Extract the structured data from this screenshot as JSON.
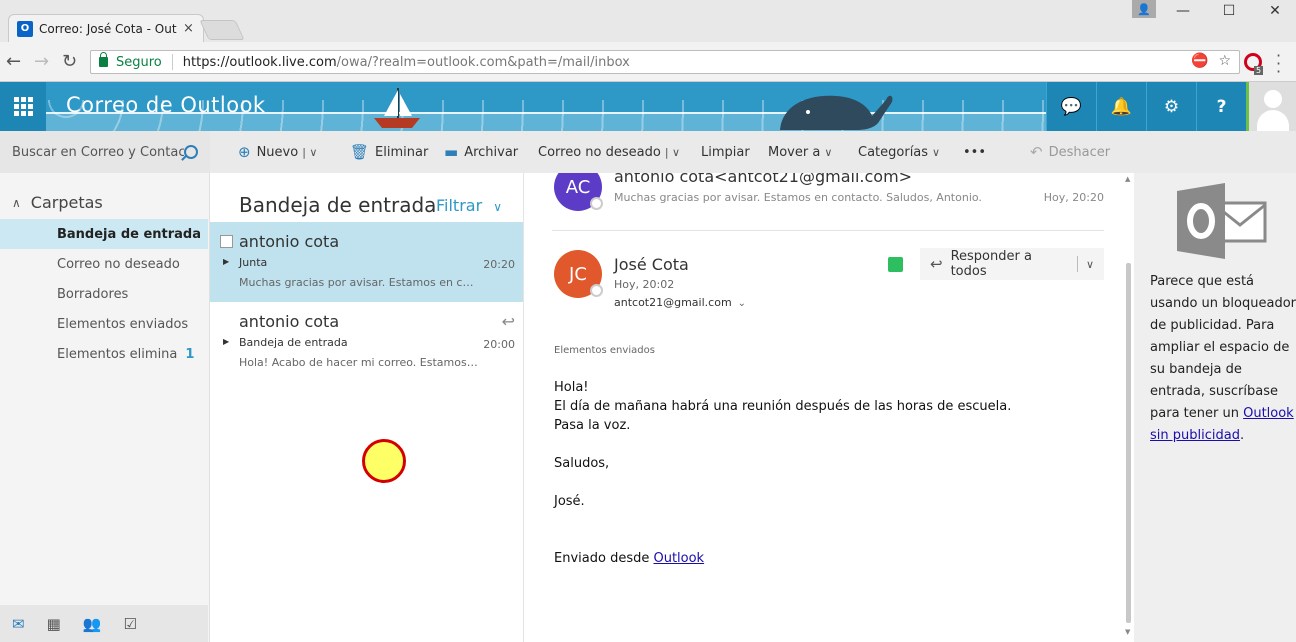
{
  "browser": {
    "tab_title": "Correo: José Cota - Outlo",
    "tab_close": "×",
    "favicon": "O",
    "secure_label": "Seguro",
    "url_host": "https://outlook.live.com",
    "url_path": "/owa/?realm=outlook.com&path=/mail/inbox",
    "window_minimize": "—",
    "window_maximize": "☐",
    "window_close": "✕",
    "back": "←",
    "forward": "→",
    "reload": "↻",
    "star": "☆",
    "opera_badge": "5"
  },
  "header": {
    "brand": "Correo de Outlook",
    "chat_icon": "💬",
    "bell_icon": "🔔",
    "gear_icon": "⚙",
    "help_label": "?"
  },
  "commands": {
    "search_placeholder": "Buscar en Correo y Contac...",
    "new_label": "Nuevo",
    "delete_label": "Eliminar",
    "archive_label": "Archivar",
    "junk_label": "Correo no deseado",
    "sweep_label": "Limpiar",
    "move_label": "Mover a",
    "categories_label": "Categorías",
    "more_label": "•••",
    "undo_label": "Deshacer"
  },
  "folders": {
    "header": "Carpetas",
    "items": [
      {
        "label": "Bandeja de entrada",
        "count": ""
      },
      {
        "label": "Correo no deseado",
        "count": ""
      },
      {
        "label": "Borradores",
        "count": ""
      },
      {
        "label": "Elementos enviados",
        "count": ""
      },
      {
        "label": "Elementos elimina",
        "count": "1"
      }
    ]
  },
  "message_list": {
    "title": "Bandeja de entrada",
    "filter": "Filtrar",
    "messages": [
      {
        "sender": "antonio cota",
        "subject": "Junta",
        "time": "20:20",
        "preview": "Muchas gracias por avisar. Estamos en contac..."
      },
      {
        "sender": "antonio cota",
        "subject": "Bandeja de entrada",
        "time": "20:00",
        "preview": "Hola! Acabo de hacer mi correo. Estamos en ..."
      }
    ]
  },
  "reading": {
    "top": {
      "initials": "AC",
      "from": "antonio cota<antcot21@gmail.com>",
      "preview": "Muchas gracias por avisar. Estamos en contacto. Saludos, Antonio.",
      "time": "Hoy, 20:20"
    },
    "main": {
      "initials": "JC",
      "from": "José Cota",
      "date": "Hoy, 20:02",
      "email": "antcot21@gmail.com",
      "reply_all": "Responder a todos",
      "folder": "Elementos enviados"
    },
    "body": {
      "l1": "Hola!",
      "l2": "El día de mañana habrá una reunión después de las horas de escuela.",
      "l3": "Pasa la voz.",
      "l4": "Saludos,",
      "l5": "José.",
      "sent_from": "Enviado desde ",
      "sent_link": "Outlook"
    }
  },
  "ad": {
    "text": "Parece que está usando un bloqueador de publicidad. Para ampliar el espacio de su bandeja de entrada, suscríbase para tener un ",
    "link": "Outlook sin publicidad",
    "end": "."
  },
  "colors": {
    "brand_blue": "#2e99c6",
    "avatar_ac": "#5c3cc7",
    "avatar_jc": "#e0582b"
  }
}
